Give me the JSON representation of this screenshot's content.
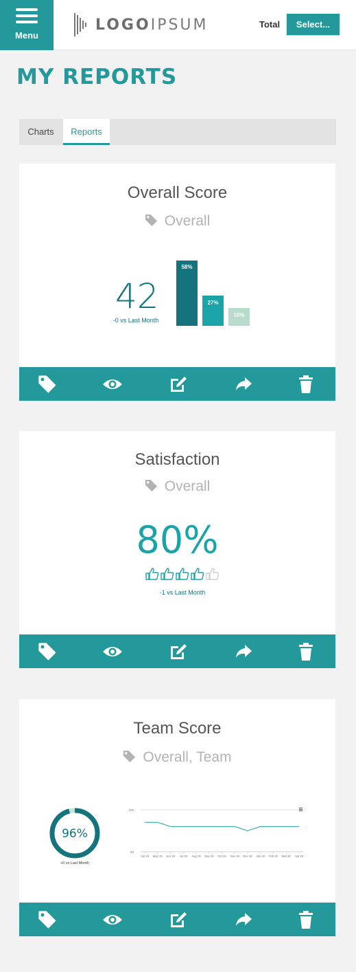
{
  "header": {
    "menu_label": "Menu",
    "logo_text_bold": "LOGO",
    "logo_text_light": "IPSUM",
    "total_label": "Total",
    "select_label": "Select..."
  },
  "page": {
    "title": "MY REPORTS"
  },
  "tabs": [
    {
      "label": "Charts",
      "active": false
    },
    {
      "label": "Reports",
      "active": true
    }
  ],
  "colors": {
    "brand": "#24999b",
    "dark_teal": "#14737c",
    "light_teal": "#1aa3a8",
    "mint": "#b7dccb"
  },
  "cards": [
    {
      "title": "Overall Score",
      "tag": "Overall",
      "score": "42",
      "comparison": "-0 vs Last Month"
    },
    {
      "title": "Satisfaction",
      "tag": "Overall",
      "score": "80%",
      "comparison": "-1 vs Last Month",
      "rating_filled": 4,
      "rating_max": 5
    },
    {
      "title": "Team Score",
      "tag": "Overall, Team",
      "score": "96%",
      "score_fraction": 0.96,
      "comparison": "+0 vs Last Month"
    }
  ],
  "actions": [
    "tag-icon",
    "eye-icon",
    "edit-icon",
    "share-icon",
    "trash-icon"
  ],
  "chart_data": [
    {
      "type": "bar",
      "categories": [
        "",
        "",
        ""
      ],
      "values": [
        58,
        27,
        16
      ],
      "data_labels": [
        "58%",
        "27%",
        "16%"
      ],
      "colors": [
        "#14737c",
        "#1aa3a8",
        "#b7dccb"
      ],
      "ylim": [
        0,
        58
      ]
    },
    {
      "type": "line",
      "categories": [
        "Apr 19",
        "May 19",
        "Jun 19",
        "Jul 19",
        "Aug 19",
        "Sep 19",
        "Oct 19",
        "Nov 19",
        "Dec 19",
        "Jan 20",
        "Feb 20",
        "Mar 20",
        "Apr 20"
      ],
      "ytick_labels": [
        "100",
        "90"
      ],
      "ylim": [
        90,
        100
      ],
      "series": [
        {
          "values": [
            97,
            97,
            96,
            96,
            96,
            96,
            96,
            96,
            95,
            96,
            96,
            96,
            96
          ]
        }
      ]
    }
  ]
}
